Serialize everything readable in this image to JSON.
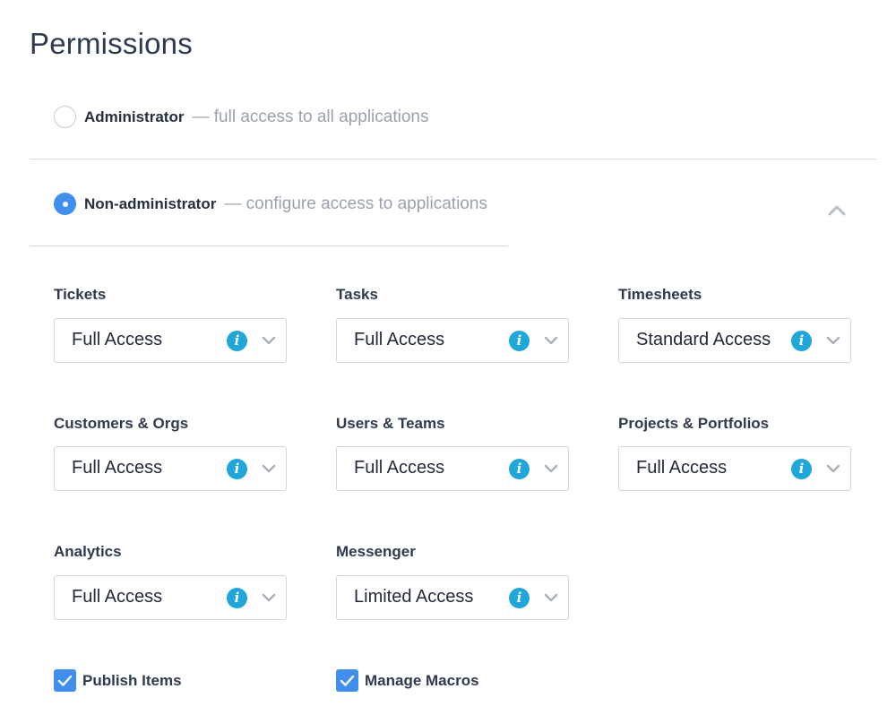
{
  "page": {
    "title": "Permissions"
  },
  "roles": {
    "admin": {
      "name": "Administrator",
      "description": "— full access to all applications",
      "selected": false
    },
    "nonadmin": {
      "name": "Non-administrator",
      "description": "— configure access to applications",
      "selected": true
    }
  },
  "permissions": [
    {
      "label": "Tickets",
      "value": "Full Access"
    },
    {
      "label": "Tasks",
      "value": "Full Access"
    },
    {
      "label": "Timesheets",
      "value": "Standard Access"
    },
    {
      "label": "Customers & Orgs",
      "value": "Full Access"
    },
    {
      "label": "Users & Teams",
      "value": "Full Access"
    },
    {
      "label": "Projects & Portfolios",
      "value": "Full Access"
    },
    {
      "label": "Analytics",
      "value": "Full Access"
    },
    {
      "label": "Messenger",
      "value": "Limited Access"
    }
  ],
  "info_glyph": "i",
  "checkboxes": [
    {
      "label": "Publish Items",
      "checked": true
    },
    {
      "label": "Manage Macros",
      "checked": true
    }
  ],
  "icons": {
    "info": "info-icon",
    "dropdown": "chevron-down-icon",
    "collapse": "chevron-up-icon",
    "check": "check-icon"
  },
  "colors": {
    "accent": "#3f8ff0",
    "info": "#1fa7d9",
    "muted_text": "#9aa1ad",
    "border": "#d3d7dd"
  }
}
